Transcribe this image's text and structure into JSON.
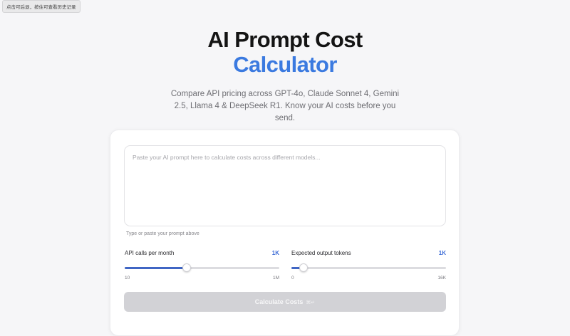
{
  "tooltip": "点击可后退，按住可查看历史记录",
  "hero": {
    "title_line1": "AI Prompt Cost",
    "title_line2": "Calculator",
    "subtitle": "Compare API pricing across GPT-4o, Claude Sonnet 4, Gemini 2.5, Llama 4 & DeepSeek R1. Know your AI costs before you send."
  },
  "prompt": {
    "placeholder": "Paste your AI prompt here to calculate costs across different models...",
    "value": "",
    "hint": "Type or paste your prompt above"
  },
  "sliders": {
    "api_calls": {
      "label": "API calls per month",
      "value_text": "1K",
      "min_label": "10",
      "max_label": "1M",
      "position_fraction": 0.4
    },
    "output_tokens": {
      "label": "Expected output tokens",
      "value_text": "1K",
      "min_label": "0",
      "max_label": "16K",
      "position_fraction": 0.08
    }
  },
  "calculate_button": {
    "label": "Calculate Costs",
    "shortcut": "⌘↵",
    "enabled": false
  },
  "colors": {
    "accent": "#3b7ae0",
    "slider_fill": "#4066c4",
    "value_text": "#3b6bd6",
    "button_disabled": "#d2d2d6"
  }
}
